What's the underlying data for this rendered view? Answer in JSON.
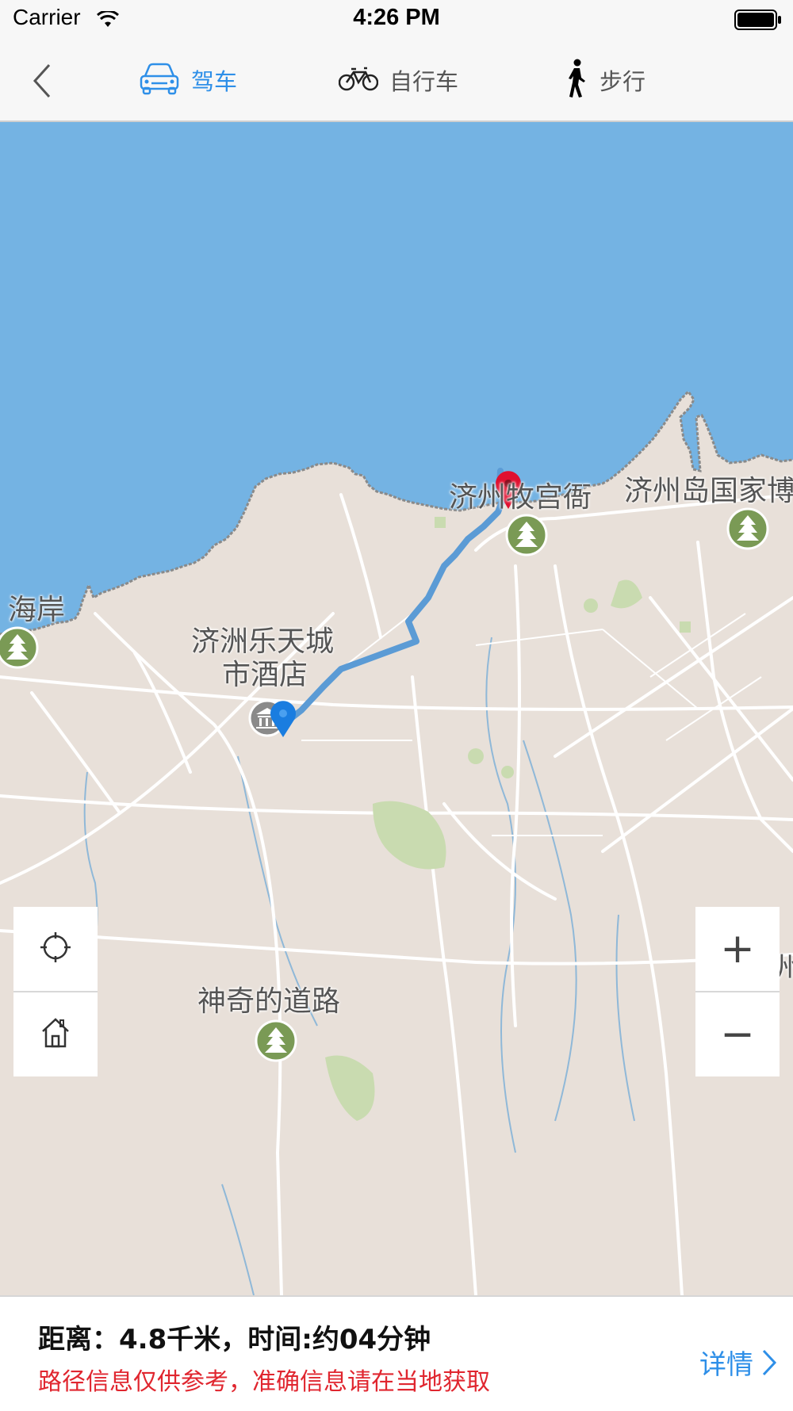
{
  "status_bar": {
    "carrier": "Carrier",
    "time": "4:26 PM"
  },
  "nav": {
    "tabs": [
      {
        "label": "驾车",
        "icon": "car-icon",
        "active": true
      },
      {
        "label": "自行车",
        "icon": "bicycle-icon",
        "active": false
      },
      {
        "label": "步行",
        "icon": "walking-person-icon",
        "active": false
      }
    ],
    "accent_color": "#2e8fe8"
  },
  "map": {
    "labels": [
      {
        "text": "济州牧宫衙"
      },
      {
        "text": "济州岛国家博"
      },
      {
        "text": "海岸"
      },
      {
        "text": "济洲乐天城"
      },
      {
        "text": "市酒店"
      },
      {
        "text": "神奇的道路"
      },
      {
        "text": "州"
      }
    ],
    "controls": {
      "locate": "locate-icon",
      "home": "home-icon",
      "zoom_in": "+",
      "zoom_out": "−"
    },
    "colors": {
      "water": "#74b3e3",
      "land": "#e8e0d9",
      "route": "#5b9bd5",
      "start_pin": "#1a7de0",
      "end_pin": "#e0102f",
      "park": "#7a9a55"
    }
  },
  "route_info": {
    "distance_text": "距离：4.8千米，时间:约04分钟",
    "disclaimer": "路径信息仅供参考，准确信息请在当地获取",
    "detail_label": "详情"
  }
}
